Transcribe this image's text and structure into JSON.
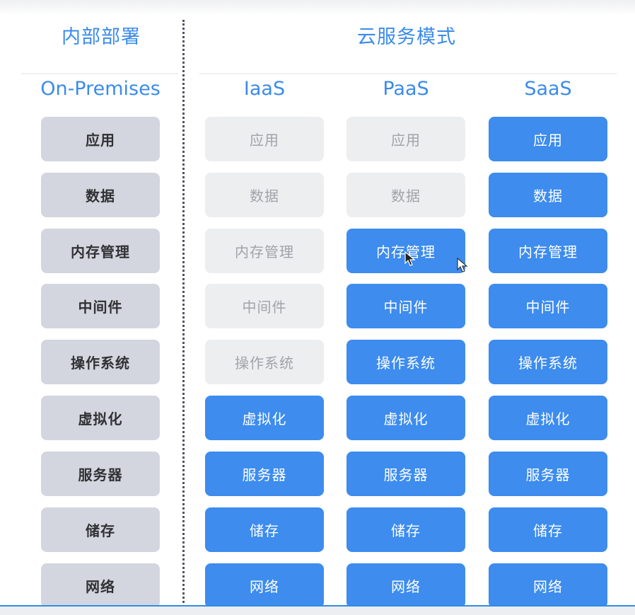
{
  "headers": {
    "on_prem_title": "内部部署",
    "cloud_title": "云服务模式"
  },
  "columns": [
    {
      "label": "On-Premises",
      "items": [
        "应用",
        "数据",
        "内存管理",
        "中间件",
        "操作系统",
        "虚拟化",
        "服务器",
        "储存",
        "网络"
      ],
      "managed": [
        false,
        false,
        false,
        false,
        false,
        false,
        false,
        false,
        false
      ]
    },
    {
      "label": "IaaS",
      "items": [
        "应用",
        "数据",
        "内存管理",
        "中间件",
        "操作系统",
        "虚拟化",
        "服务器",
        "储存",
        "网络"
      ],
      "managed": [
        false,
        false,
        false,
        false,
        false,
        true,
        true,
        true,
        true
      ]
    },
    {
      "label": "PaaS",
      "items": [
        "应用",
        "数据",
        "内存管理",
        "中间件",
        "操作系统",
        "虚拟化",
        "服务器",
        "储存",
        "网络"
      ],
      "managed": [
        false,
        false,
        true,
        true,
        true,
        true,
        true,
        true,
        true
      ]
    },
    {
      "label": "SaaS",
      "items": [
        "应用",
        "数据",
        "内存管理",
        "中间件",
        "操作系统",
        "虚拟化",
        "服务器",
        "储存",
        "网络"
      ],
      "managed": [
        true,
        true,
        true,
        true,
        true,
        true,
        true,
        true,
        true
      ]
    }
  ],
  "colors": {
    "accent": "#3b8bea",
    "provider_managed": "#3d8cee",
    "self_managed_on_prem": "#d3d6de",
    "self_managed_cloud": "#edeef0"
  }
}
